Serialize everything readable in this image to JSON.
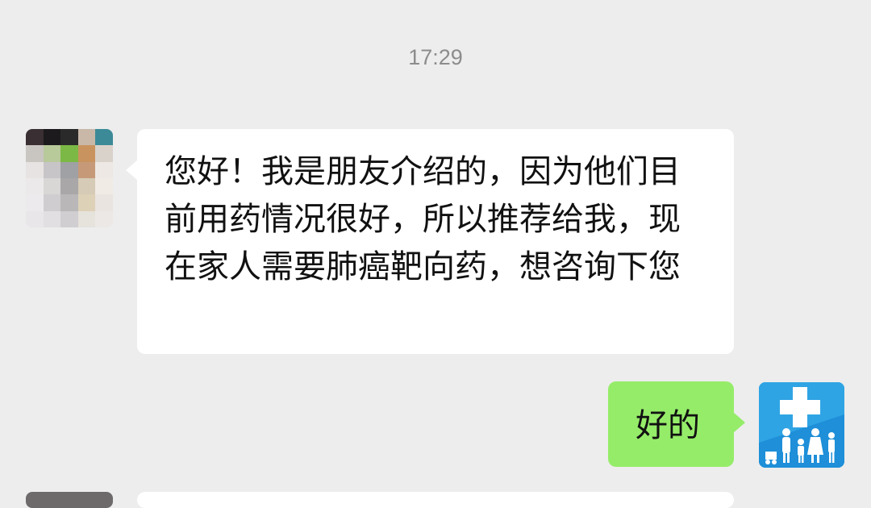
{
  "chat": {
    "timestamp": "17:29",
    "messages": [
      {
        "sender": "contact",
        "text": "您好！我是朋友介绍的，因为他们目前用药情况很好，所以推荐给我，现在家人需要肺癌靶向药，想咨询下您"
      },
      {
        "sender": "me",
        "text": "好的"
      }
    ]
  },
  "colors": {
    "background": "#ededed",
    "incoming_bubble": "#ffffff",
    "outgoing_bubble": "#95ec69",
    "timestamp": "#8c8c8c",
    "logo_blue": "#1b86d1"
  },
  "icons": {
    "contact_avatar": "pixelated-avatar-icon",
    "my_avatar": "medical-cross-family-icon"
  }
}
